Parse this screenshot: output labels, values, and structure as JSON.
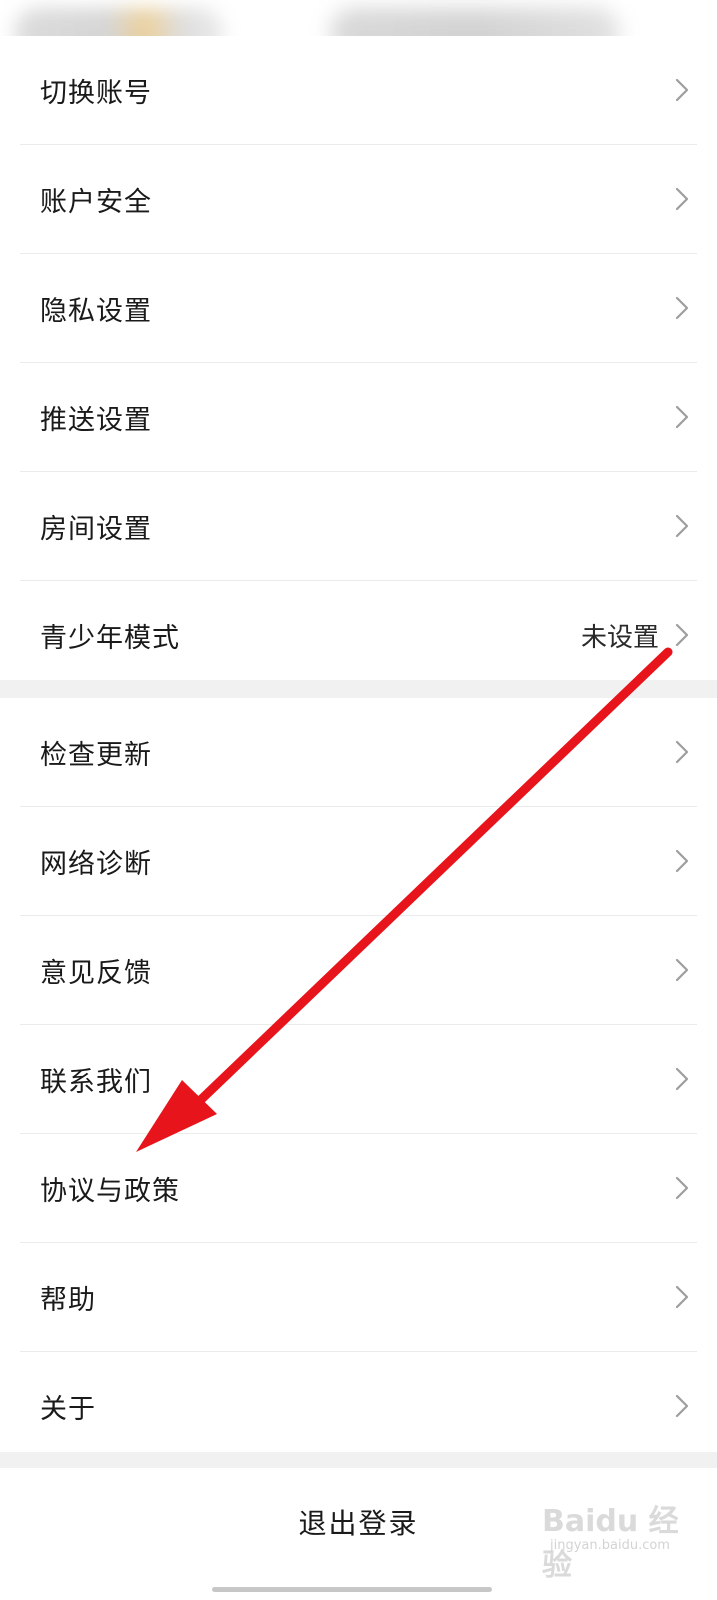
{
  "settings_group_1": {
    "items": [
      {
        "label": "切换账号",
        "value": ""
      },
      {
        "label": "账户安全",
        "value": ""
      },
      {
        "label": "隐私设置",
        "value": ""
      },
      {
        "label": "推送设置",
        "value": ""
      },
      {
        "label": "房间设置",
        "value": ""
      },
      {
        "label": "青少年模式",
        "value": "未设置"
      }
    ]
  },
  "settings_group_2": {
    "items": [
      {
        "label": "检查更新"
      },
      {
        "label": "网络诊断"
      },
      {
        "label": "意见反馈"
      },
      {
        "label": "联系我们"
      },
      {
        "label": "协议与政策"
      },
      {
        "label": "帮助"
      },
      {
        "label": "关于"
      }
    ]
  },
  "logout": {
    "label": "退出登录"
  },
  "watermark": {
    "brand": "Baidu 经验",
    "url": "jingyan.baidu.com"
  },
  "icons": {
    "row_chevron": "chevron-right-icon"
  },
  "colors": {
    "annotation_arrow": "#e8141c",
    "separator": "#ebebeb",
    "group_gap": "#f1f1f1"
  }
}
